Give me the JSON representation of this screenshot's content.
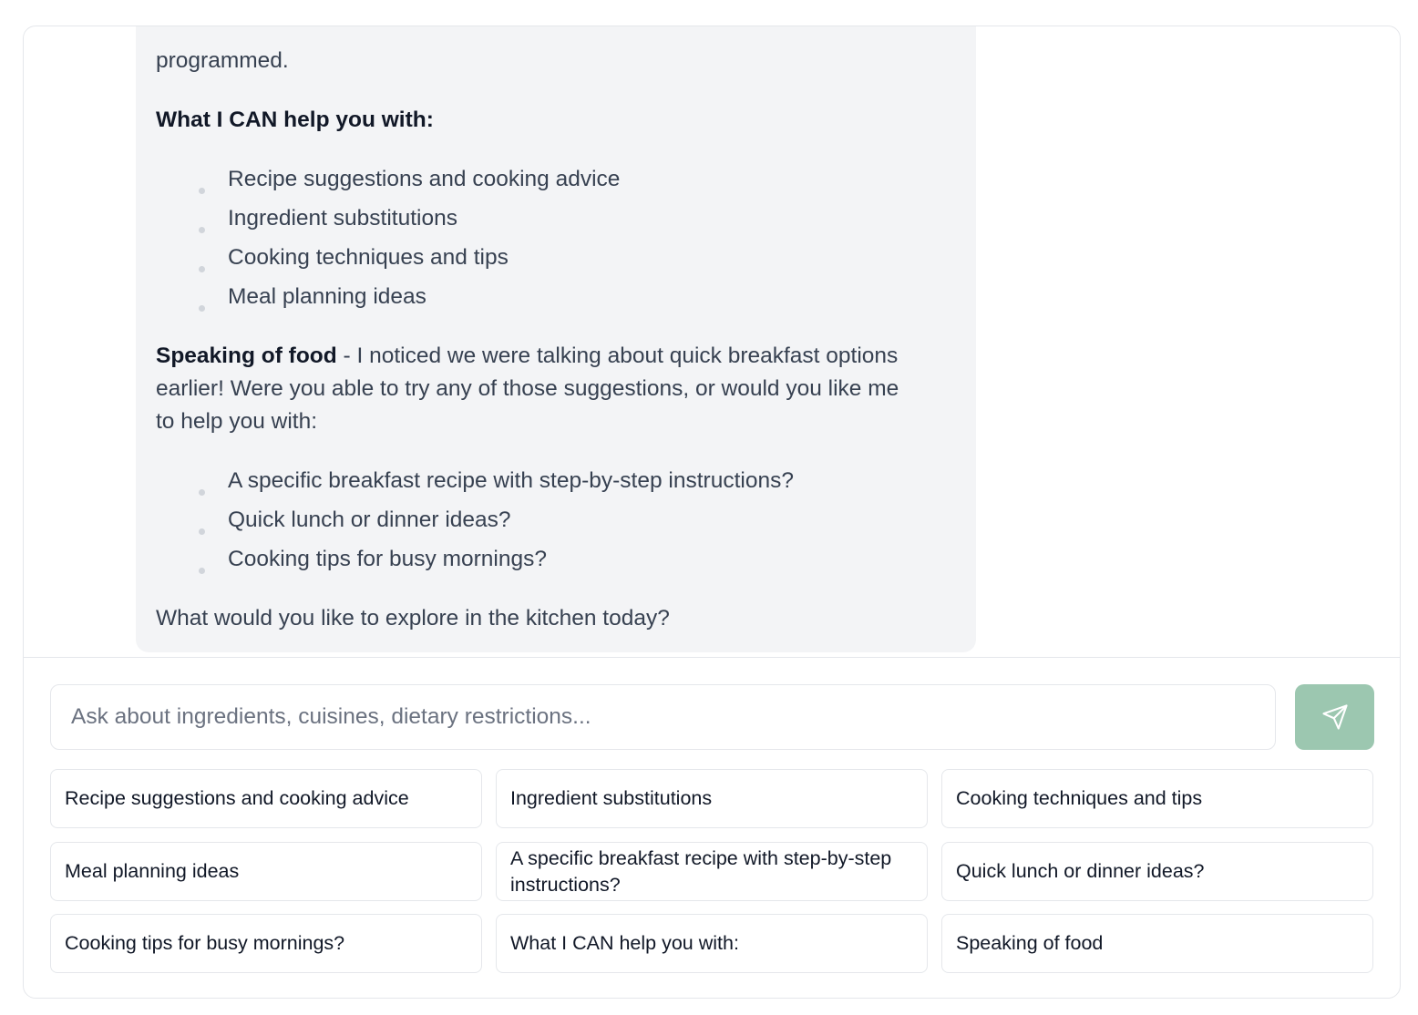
{
  "message": {
    "intro_tail": "programmed.",
    "can_help_heading": "What I CAN help you with:",
    "can_help_items": [
      "Recipe suggestions and cooking advice",
      "Ingredient substitutions",
      "Cooking techniques and tips",
      "Meal planning ideas"
    ],
    "speaking_bold": "Speaking of food",
    "speaking_line1_rest": " - I noticed we were talking about quick breakfast options",
    "speaking_line2": "earlier! Were you able to try any of those suggestions, or would you like me",
    "speaking_line3": "to help you with:",
    "followup_items": [
      "A specific breakfast recipe with step-by-step instructions?",
      "Quick lunch or dinner ideas?",
      "Cooking tips for busy mornings?"
    ],
    "closing": "What would you like to explore in the kitchen today?"
  },
  "composer": {
    "placeholder": "Ask about ingredients, cuisines, dietary restrictions...",
    "value": "",
    "send_icon": "paper-plane-icon",
    "send_color": "#9cc7b0"
  },
  "suggestions": [
    "Recipe suggestions and cooking advice",
    "Ingredient substitutions",
    "Cooking techniques and tips",
    "Meal planning ideas",
    "A specific breakfast recipe with step-by-step instructions?",
    "Quick lunch or dinner ideas?",
    "Cooking tips for busy mornings?",
    "What I CAN help you with:",
    "Speaking of food"
  ]
}
